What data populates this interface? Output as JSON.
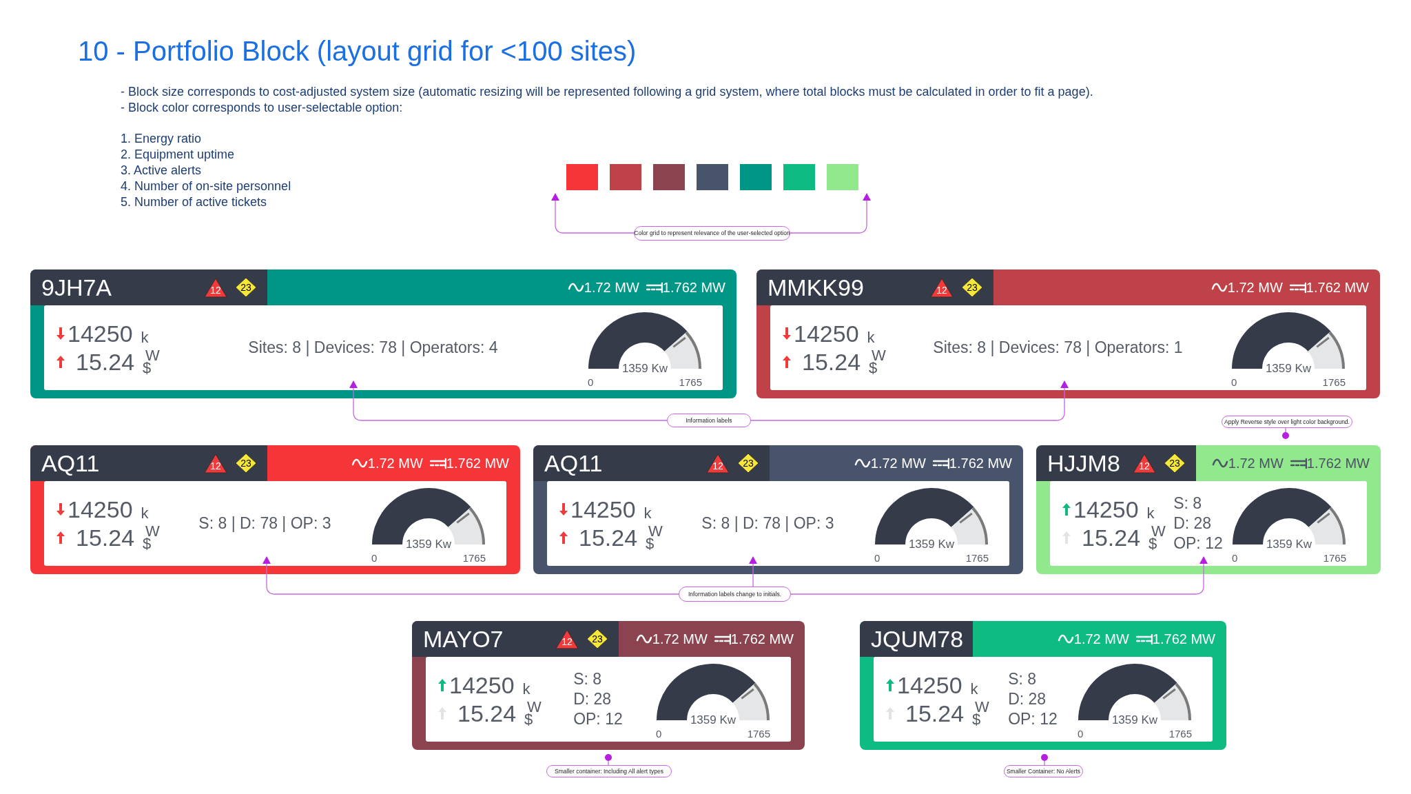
{
  "title": "10 - Portfolio Block (layout grid for <100 sites)",
  "notes": [
    "- Block size corresponds to cost-adjusted system size (automatic resizing will be represented following a grid system, where total blocks must be calculated in order to fit a page).",
    "- Block color corresponds to user-selectable option:"
  ],
  "options": [
    "1. Energy ratio",
    "2. Equipment uptime",
    "3. Active alerts",
    "4. Number of on-site personnel",
    "5. Number of active tickets"
  ],
  "swatches": [
    {
      "color": "#f63539"
    },
    {
      "color": "#be4247"
    },
    {
      "color": "#8b444f"
    },
    {
      "color": "#48546c"
    },
    {
      "color": "#009685"
    },
    {
      "color": "#0dbb83"
    },
    {
      "color": "#91e88d"
    }
  ],
  "rows": [
    {
      "cards": [
        {
          "id": "9JH7A",
          "color": "#009685",
          "reverse": false,
          "alerts": [
            {
              "kind": "triangle",
              "count": "12"
            },
            {
              "kind": "diamond",
              "count": "23"
            }
          ],
          "power": [
            {
              "kind": "ac",
              "value": "1.72 MW"
            },
            {
              "kind": "dc",
              "value": "1.762 MW"
            }
          ],
          "energy": {
            "value": "14250",
            "unit": "k",
            "trend": {
              "rising": false,
              "color": "#ef3b3b"
            }
          },
          "cost": {
            "value": "15.24",
            "unit_top": "W",
            "unit_bottom": "$",
            "trend": {
              "rising": true,
              "color": "#ef3b3b"
            }
          },
          "stats": [
            "Sites: 8 | Devices: 78 | Operators: 4"
          ],
          "gauge": {
            "reading": "1359 Kw",
            "min": "0",
            "max": "1765"
          }
        },
        {
          "id": "MMKK99",
          "color": "#be4247",
          "reverse": false,
          "alerts": [
            {
              "kind": "triangle",
              "count": "12"
            },
            {
              "kind": "diamond",
              "count": "23"
            }
          ],
          "power": [
            {
              "kind": "ac",
              "value": "1.72 MW"
            },
            {
              "kind": "dc",
              "value": "1.762 MW"
            }
          ],
          "energy": {
            "value": "14250",
            "unit": "k",
            "trend": {
              "rising": false,
              "color": "#ef3b3b"
            }
          },
          "cost": {
            "value": "15.24",
            "unit_top": "W",
            "unit_bottom": "$",
            "trend": {
              "rising": true,
              "color": "#ef3b3b"
            }
          },
          "stats": [
            "Sites: 8 | Devices: 78 | Operators: 1"
          ],
          "gauge": {
            "reading": "1359 Kw",
            "min": "0",
            "max": "1765"
          }
        }
      ]
    },
    {
      "cards": [
        {
          "id": "AQ11",
          "color": "#f63539",
          "reverse": false,
          "alerts": [
            {
              "kind": "triangle",
              "count": "12"
            },
            {
              "kind": "diamond",
              "count": "23"
            }
          ],
          "power": [
            {
              "kind": "ac",
              "value": "1.72 MW"
            },
            {
              "kind": "dc",
              "value": "1.762 MW"
            }
          ],
          "energy": {
            "value": "14250",
            "unit": "k",
            "trend": {
              "rising": false,
              "color": "#ef3b3b"
            }
          },
          "cost": {
            "value": "15.24",
            "unit_top": "W",
            "unit_bottom": "$",
            "trend": {
              "rising": true,
              "color": "#ef3b3b"
            }
          },
          "stats": [
            "S: 8 | D: 78 | OP: 3"
          ],
          "gauge": {
            "reading": "1359 Kw",
            "min": "0",
            "max": "1765"
          }
        },
        {
          "id": "AQ11",
          "color": "#48546c",
          "reverse": false,
          "alerts": [
            {
              "kind": "triangle",
              "count": "12"
            },
            {
              "kind": "diamond",
              "count": "23"
            }
          ],
          "power": [
            {
              "kind": "ac",
              "value": "1.72 MW"
            },
            {
              "kind": "dc",
              "value": "1.762 MW"
            }
          ],
          "energy": {
            "value": "14250",
            "unit": "k",
            "trend": {
              "rising": false,
              "color": "#ef3b3b"
            }
          },
          "cost": {
            "value": "15.24",
            "unit_top": "W",
            "unit_bottom": "$",
            "trend": {
              "rising": true,
              "color": "#ef3b3b"
            }
          },
          "stats": [
            "S: 8 | D: 78 | OP: 3"
          ],
          "gauge": {
            "reading": "1359 Kw",
            "min": "0",
            "max": "1765"
          }
        },
        {
          "id": "HJJM8",
          "color": "#91e88d",
          "reverse": true,
          "alerts": [
            {
              "kind": "triangle",
              "count": "12"
            },
            {
              "kind": "diamond",
              "count": "23"
            }
          ],
          "power": [
            {
              "kind": "ac",
              "value": "1.72 MW"
            },
            {
              "kind": "dc",
              "value": "1.762 MW"
            }
          ],
          "energy": {
            "value": "14250",
            "unit": "k",
            "trend": {
              "rising": true,
              "color": "#10b981"
            }
          },
          "cost": {
            "value": "15.24",
            "unit_top": "W",
            "unit_bottom": "$",
            "trend": {
              "rising": true,
              "color": "#e3e3e3"
            }
          },
          "stats": [
            "S: 8",
            "D: 28",
            "OP: 12"
          ],
          "gauge": {
            "reading": "1359 Kw",
            "min": "0",
            "max": "1765"
          }
        }
      ]
    },
    {
      "cards": [
        {
          "id": "MAYO7",
          "color": "#8b444f",
          "reverse": false,
          "alerts": [
            {
              "kind": "triangle",
              "count": "12"
            },
            {
              "kind": "diamond",
              "count": "23"
            }
          ],
          "power": [
            {
              "kind": "ac",
              "value": "1.72 MW"
            },
            {
              "kind": "dc",
              "value": "1.762 MW"
            }
          ],
          "energy": {
            "value": "14250",
            "unit": "k",
            "trend": {
              "rising": true,
              "color": "#10b981"
            }
          },
          "cost": {
            "value": "15.24",
            "unit_top": "W",
            "unit_bottom": "$",
            "trend": {
              "rising": true,
              "color": "#e3e3e3"
            }
          },
          "stats": [
            "S: 8",
            "D: 28",
            "OP: 12"
          ],
          "gauge": {
            "reading": "1359 Kw",
            "min": "0",
            "max": "1765"
          }
        },
        {
          "id": "JQUM78",
          "color": "#0dbb83",
          "reverse": false,
          "power": [
            {
              "kind": "ac",
              "value": "1.72 MW"
            },
            {
              "kind": "dc",
              "value": "1.762 MW"
            }
          ],
          "energy": {
            "value": "14250",
            "unit": "k",
            "trend": {
              "rising": true,
              "color": "#10b981"
            }
          },
          "cost": {
            "value": "15.24",
            "unit_top": "W",
            "unit_bottom": "$",
            "trend": {
              "rising": true,
              "color": "#e3e3e3"
            }
          },
          "stats": [
            "S: 8",
            "D: 28",
            "OP: 12"
          ],
          "gauge": {
            "reading": "1359 Kw",
            "min": "0",
            "max": "1765"
          }
        }
      ]
    }
  ],
  "annotations": [
    {
      "text": "Color grid to represent relevance of the user-selected option"
    },
    {
      "text": "Information labels"
    },
    {
      "text": "Apply Reverse style over light color background."
    },
    {
      "text": "Information labels change to initials."
    },
    {
      "text": "Smaller container: Including All alert types"
    },
    {
      "text": "Smaller Container: No Alerts"
    }
  ]
}
